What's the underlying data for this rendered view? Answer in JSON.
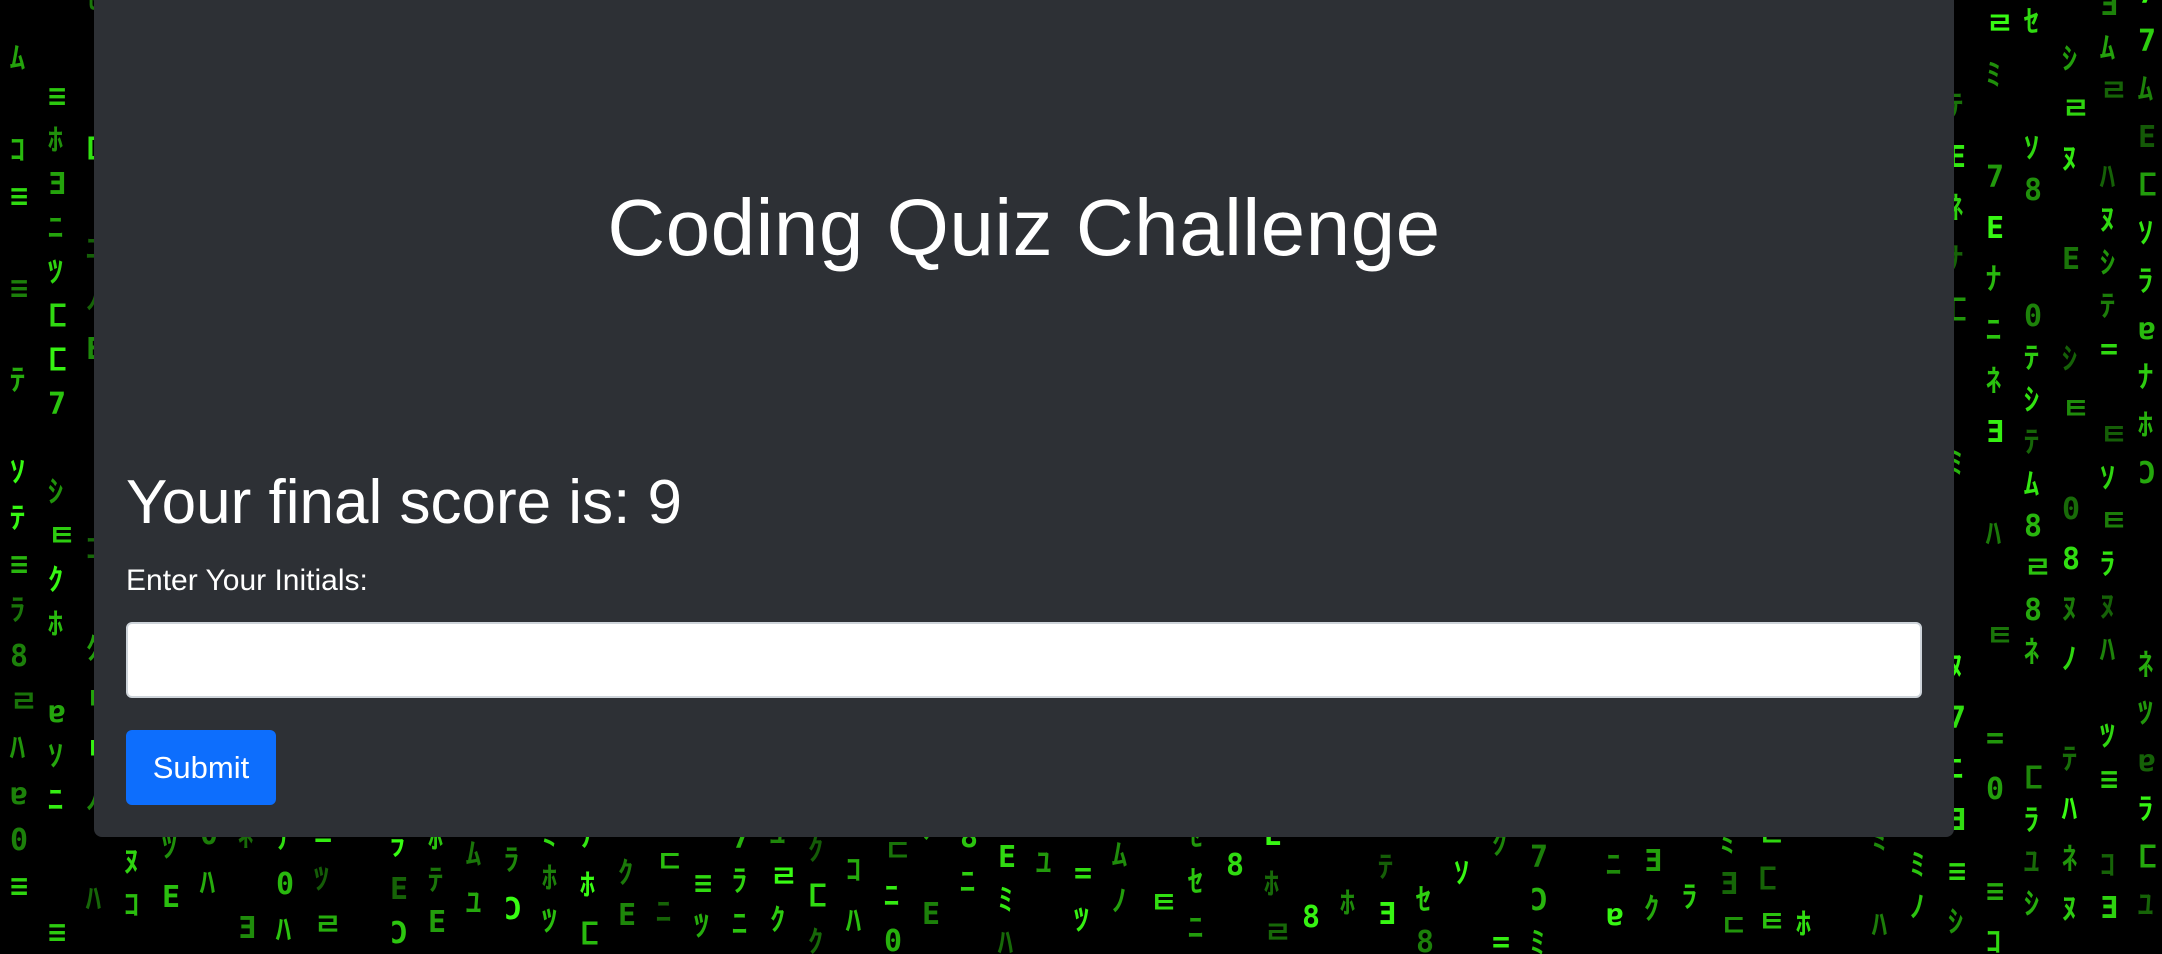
{
  "quiz": {
    "title": "Coding Quiz Challenge",
    "final_score_text": "Your final score is: 9",
    "initials_label": "Enter Your Initials:",
    "initials_value": "",
    "submit_label": "Submit"
  },
  "theme": {
    "card_bg": "#2d3035",
    "button_color": "#0d6efd",
    "matrix_glyph_color": "#39ff14"
  }
}
